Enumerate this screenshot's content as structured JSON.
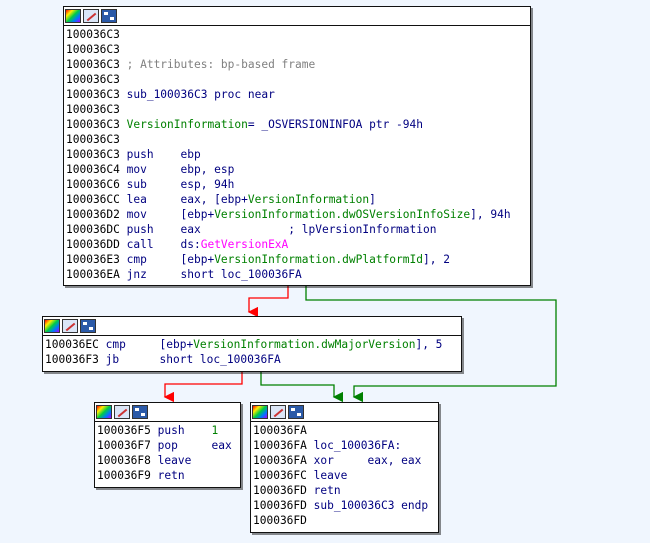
{
  "nodes": {
    "a": {
      "lines": [
        {
          "addr": "100036C3",
          "segs": []
        },
        {
          "addr": "100036C3",
          "segs": []
        },
        {
          "addr": "100036C3",
          "segs": [
            {
              "t": " ; Attributes: bp-based frame",
              "c": "cmt"
            }
          ]
        },
        {
          "addr": "100036C3",
          "segs": []
        },
        {
          "addr": "100036C3",
          "segs": [
            {
              "t": " sub_100036C3 proc near",
              "c": "kw"
            }
          ]
        },
        {
          "addr": "100036C3",
          "segs": []
        },
        {
          "addr": "100036C3",
          "segs": [
            {
              "t": " VersionInformation",
              "c": "var"
            },
            {
              "t": "= _OSVERSIONINFOA ptr -94h",
              "c": "kw"
            }
          ]
        },
        {
          "addr": "100036C3",
          "segs": []
        },
        {
          "addr": "100036C3",
          "segs": [
            {
              "t": " push    ebp",
              "c": "kw"
            }
          ]
        },
        {
          "addr": "100036C4",
          "segs": [
            {
              "t": " mov     ebp, esp",
              "c": "kw"
            }
          ]
        },
        {
          "addr": "100036C6",
          "segs": [
            {
              "t": " sub     esp, 94h",
              "c": "kw"
            }
          ]
        },
        {
          "addr": "100036CC",
          "segs": [
            {
              "t": " lea     eax, [ebp+",
              "c": "kw"
            },
            {
              "t": "VersionInformation",
              "c": "var"
            },
            {
              "t": "]",
              "c": "kw"
            }
          ]
        },
        {
          "addr": "100036D2",
          "segs": [
            {
              "t": " mov     [ebp+",
              "c": "kw"
            },
            {
              "t": "VersionInformation.dwOSVersionInfoSize",
              "c": "var"
            },
            {
              "t": "], 94h",
              "c": "kw"
            }
          ]
        },
        {
          "addr": "100036DC",
          "segs": [
            {
              "t": " push    eax             ",
              "c": "kw"
            },
            {
              "t": "; lpVersionInformation",
              "c": "kw"
            }
          ]
        },
        {
          "addr": "100036DD",
          "segs": [
            {
              "t": " call    ds:",
              "c": "kw"
            },
            {
              "t": "GetVersionExA",
              "c": "api"
            }
          ]
        },
        {
          "addr": "100036E3",
          "segs": [
            {
              "t": " cmp     [ebp+",
              "c": "kw"
            },
            {
              "t": "VersionInformation.dwPlatformId",
              "c": "var"
            },
            {
              "t": "], 2",
              "c": "kw"
            }
          ]
        },
        {
          "addr": "100036EA",
          "segs": [
            {
              "t": " jnz     short loc_100036FA",
              "c": "kw"
            }
          ]
        }
      ]
    },
    "b": {
      "lines": [
        {
          "addr": "100036EC",
          "segs": [
            {
              "t": " cmp     [ebp+",
              "c": "kw"
            },
            {
              "t": "VersionInformation.dwMajorVersion",
              "c": "var"
            },
            {
              "t": "], 5",
              "c": "kw"
            }
          ]
        },
        {
          "addr": "100036F3",
          "segs": [
            {
              "t": " jb      short loc_100036FA",
              "c": "kw"
            }
          ]
        }
      ]
    },
    "c": {
      "lines": [
        {
          "addr": "100036F5",
          "segs": [
            {
              "t": " push    ",
              "c": "kw"
            },
            {
              "t": "1",
              "c": "var"
            }
          ]
        },
        {
          "addr": "100036F7",
          "segs": [
            {
              "t": " pop     eax",
              "c": "kw"
            }
          ]
        },
        {
          "addr": "100036F8",
          "segs": [
            {
              "t": " leave",
              "c": "kw"
            }
          ]
        },
        {
          "addr": "100036F9",
          "segs": [
            {
              "t": " retn",
              "c": "kw"
            }
          ]
        }
      ]
    },
    "d": {
      "lines": [
        {
          "addr": "100036FA",
          "segs": []
        },
        {
          "addr": "100036FA",
          "segs": [
            {
              "t": " loc_100036FA:",
              "c": "kw"
            }
          ]
        },
        {
          "addr": "100036FA",
          "segs": [
            {
              "t": " xor     eax, eax",
              "c": "kw"
            }
          ]
        },
        {
          "addr": "100036FC",
          "segs": [
            {
              "t": " leave",
              "c": "kw"
            }
          ]
        },
        {
          "addr": "100036FD",
          "segs": [
            {
              "t": " retn",
              "c": "kw"
            }
          ]
        },
        {
          "addr": "100036FD",
          "segs": [
            {
              "t": " sub_100036C3 endp",
              "c": "kw"
            }
          ]
        },
        {
          "addr": "100036FD",
          "segs": []
        }
      ]
    }
  },
  "colors": {
    "background": "#f0f6fe",
    "address": "#000000",
    "instruction": "#000080",
    "comment": "#808080",
    "variable": "#008000",
    "api_call": "#ff00ff",
    "edge_false": "#ff0000",
    "edge_true": "#008000"
  },
  "header_icons": [
    "color-palette-icon",
    "edit-node-icon",
    "graph-node-icon"
  ]
}
